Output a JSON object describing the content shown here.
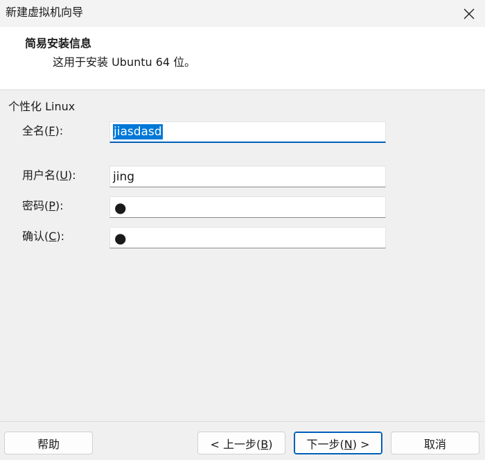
{
  "window": {
    "title": "新建虚拟机向导",
    "close_icon": "close-icon"
  },
  "header": {
    "title": "简易安装信息",
    "subtitle": "这用于安装 Ubuntu 64 位。"
  },
  "section": {
    "label": "个性化 Linux"
  },
  "fields": {
    "fullname": {
      "label_prefix": "全名(",
      "label_key": "F",
      "label_suffix": "):",
      "value": "jiasdasd"
    },
    "username": {
      "label_prefix": "用户名(",
      "label_key": "U",
      "label_suffix": "):",
      "value": "jing"
    },
    "password": {
      "label_prefix": "密码(",
      "label_key": "P",
      "label_suffix": "):",
      "value": "●"
    },
    "confirm": {
      "label_prefix": "确认(",
      "label_key": "C",
      "label_suffix": "):",
      "value": "●"
    }
  },
  "buttons": {
    "help": "帮助",
    "back_prefix": "< 上一步(",
    "back_key": "B",
    "back_suffix": ")",
    "next_prefix": "下一步(",
    "next_key": "N",
    "next_suffix": ") >",
    "cancel": "取消"
  },
  "colors": {
    "accent": "#005fb8",
    "selection": "#0078d7"
  }
}
